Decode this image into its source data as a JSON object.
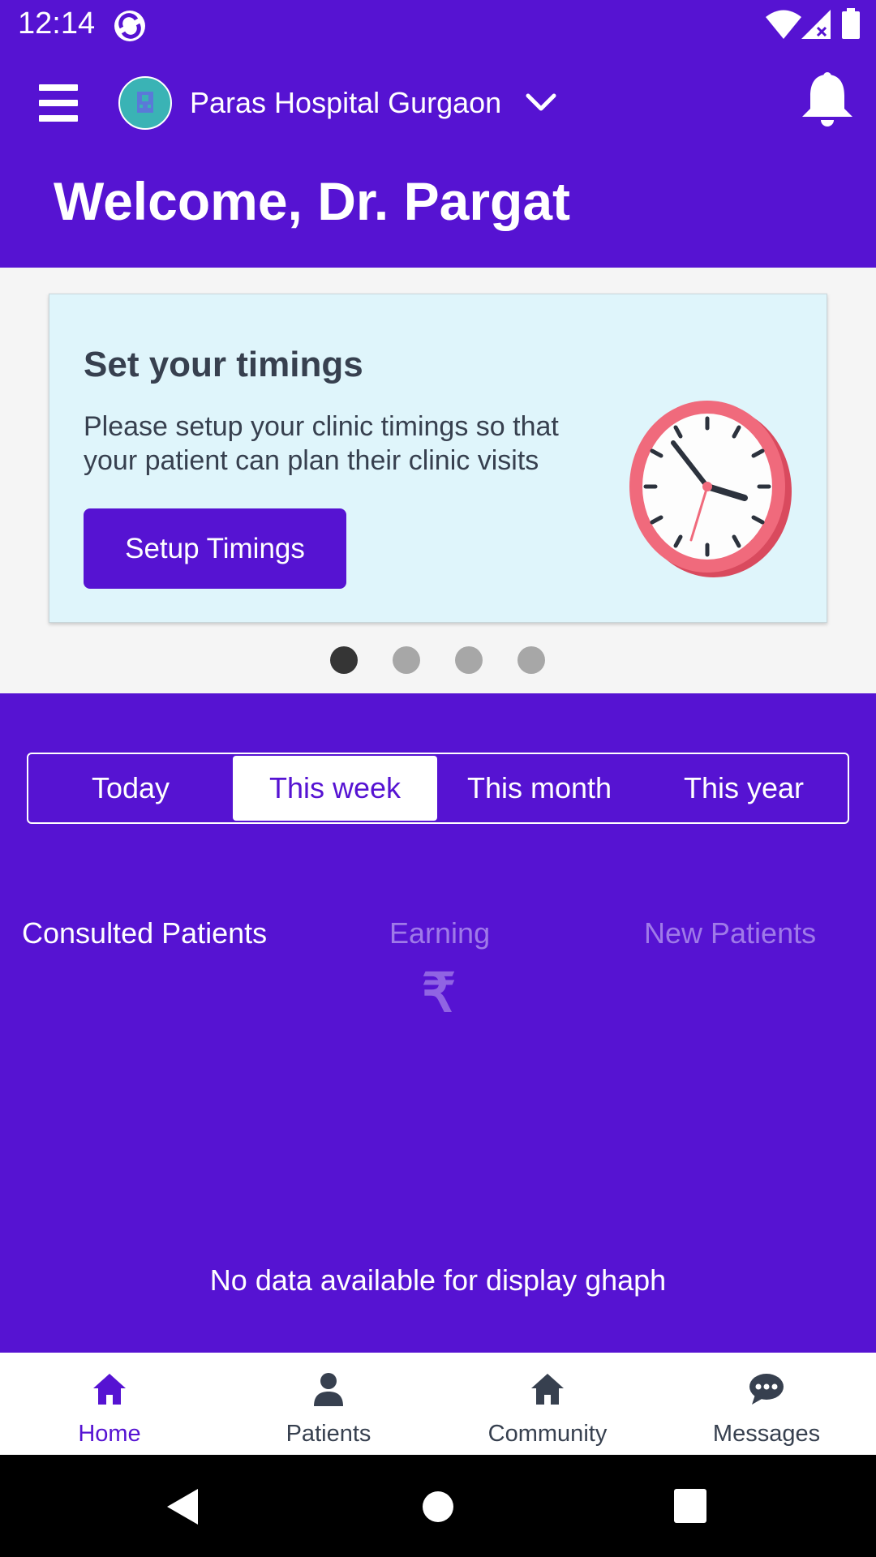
{
  "status_bar": {
    "time": "12:14"
  },
  "header": {
    "hospital_name": "Paras Hospital Gurgaon",
    "welcome": "Welcome, Dr. Pargat"
  },
  "banner": {
    "title": "Set your timings",
    "description": "Please setup your clinic timings so that your patient can plan their clinic visits",
    "button_label": "Setup Timings",
    "pages": 4,
    "active_page": 1
  },
  "period_tabs": [
    {
      "label": "Today"
    },
    {
      "label": "This week"
    },
    {
      "label": "This month"
    },
    {
      "label": "This year"
    }
  ],
  "selected_period": "This week",
  "stats": {
    "consulted": "Consulted Patients",
    "earning": "Earning",
    "new_patients": "New Patients",
    "currency_symbol": "₹"
  },
  "graph": {
    "empty_message": "No data available for display ghaph"
  },
  "bottom_nav": [
    {
      "label": "Home",
      "icon": "home-icon"
    },
    {
      "label": "Patients",
      "icon": "person-icon"
    },
    {
      "label": "Community",
      "icon": "community-home-icon"
    },
    {
      "label": "Messages",
      "icon": "chat-bubble-icon"
    }
  ],
  "colors": {
    "primary": "#5613d2",
    "card_background": "#dff5fb",
    "muted_text": "#9f7ae8",
    "dark_text": "#37404f"
  }
}
